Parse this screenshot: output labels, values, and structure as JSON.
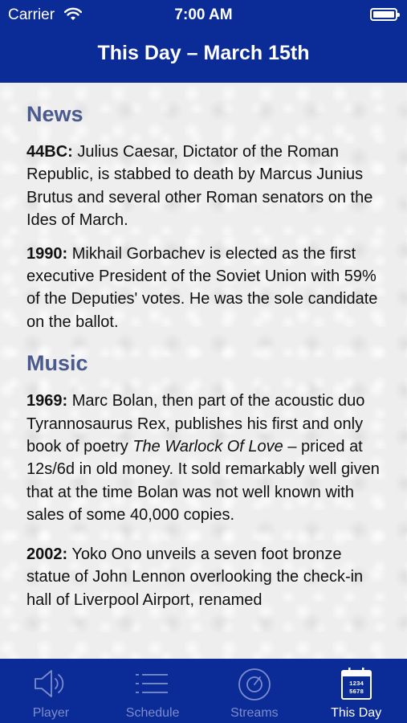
{
  "status_bar": {
    "carrier": "Carrier",
    "time": "7:00 AM"
  },
  "header": {
    "title": "This Day – March 15th"
  },
  "sections": [
    {
      "title": "News",
      "entries": [
        {
          "year": "44BC:",
          "text": " Julius Caesar, Dictator of the Roman Republic, is stabbed to death by Marcus Junius Brutus and several other Roman senators on the Ides of March."
        },
        {
          "year": "1990:",
          "text": " Mikhail Gorbachev is elected as the first executive President of the Soviet Union with 59% of the Deputies' votes. He was the sole candidate on the ballot."
        }
      ]
    },
    {
      "title": "Music",
      "entries": [
        {
          "year": "1969:",
          "text_before": " Marc Bolan, then part of the acoustic duo Tyrannosaurus Rex, publishes his first and only book of poetry ",
          "italic": "The Warlock Of Love",
          "text_after": " – priced at 12s/6d in old money. It sold remarkably well given that at the time Bolan was not well known with sales of some 40,000 copies."
        },
        {
          "year": "2002:",
          "text": " Yoko Ono unveils a seven foot bronze statue of John Lennon overlooking the check-in hall of Liverpool Airport, renamed"
        }
      ]
    }
  ],
  "tabbar": {
    "tabs": [
      {
        "label": "Player",
        "icon": "speaker-icon",
        "active": false
      },
      {
        "label": "Schedule",
        "icon": "list-icon",
        "active": false
      },
      {
        "label": "Streams",
        "icon": "disc-icon",
        "active": false
      },
      {
        "label": "This Day",
        "icon": "calendar-icon",
        "active": true
      }
    ],
    "colors": {
      "active": "#ffffff",
      "inactive": "#7d8ccc",
      "background": "#0b2b97"
    }
  }
}
